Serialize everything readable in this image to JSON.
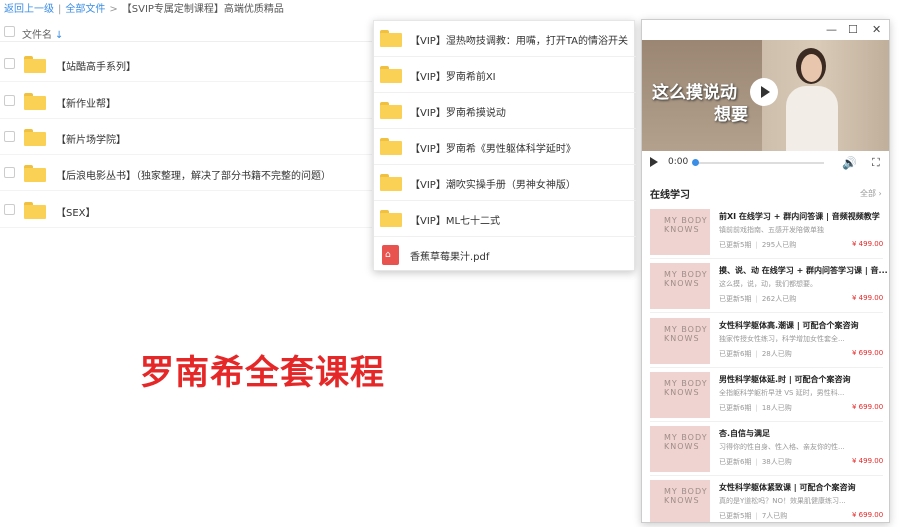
{
  "breadcrumb": {
    "back": "返回上一级",
    "all": "全部文件",
    "sep": ">",
    "current": "【SVIP专属定制课程】高端优质精品"
  },
  "file_list": {
    "header": "文件名",
    "sort_icon": "↓",
    "rows": [
      {
        "name": "【站酷高手系列】"
      },
      {
        "name": "【新作业帮】"
      },
      {
        "name": "【新片场学院】"
      },
      {
        "name": "【后浪电影丛书】（独家整理，解决了部分书籍不完整的问题）"
      },
      {
        "name": "【SEX】"
      }
    ]
  },
  "dropdown": {
    "items": [
      {
        "name": "【VIP】湿热吻技调教：用嘴，打开TA的情浴开关",
        "type": "folder"
      },
      {
        "name": "【VIP】罗南希前XI",
        "type": "folder"
      },
      {
        "name": "【VIP】罗南希摸说动",
        "type": "folder"
      },
      {
        "name": "【VIP】罗南希《男性躯体科学延时》",
        "type": "folder"
      },
      {
        "name": "【VIP】潮吹实操手册（男神女神版）",
        "type": "folder"
      },
      {
        "name": "【VIP】ML七十二式",
        "type": "folder"
      },
      {
        "name": "香蕉草莓果汁.pdf",
        "type": "pdf"
      }
    ]
  },
  "promo_text": "罗南希全套课程",
  "player_window": {
    "controls": {
      "minimize": "—",
      "maximize": "☐",
      "close": "✕"
    },
    "video": {
      "overlay_line1": "这么摸说动",
      "overlay_line2": "想要",
      "time": "0:00"
    },
    "section_title": "在线学习",
    "see_all": "全部 ›",
    "thumb_label": "MY BODY KNOWS",
    "courses": [
      {
        "title": "前XI 在线学习 + 群内问答课 | 音频视频教学",
        "desc": "镇前前戏指南、五感开发陪做单独",
        "updated": "已更新5期",
        "buyers": "295人已购",
        "price": "¥ 499.00"
      },
      {
        "title": "摸、说、动 在线学习 + 群内问答学习课 | 音...",
        "desc": "这么摸，说，动，我们都想要。",
        "updated": "已更新5期",
        "buyers": "262人已购",
        "price": "¥ 499.00"
      },
      {
        "title": "女性科学躯体高.潮课 | 可配合个案咨询",
        "desc": "独家传授女性练习，科学增加女性套全...",
        "updated": "已更新6期",
        "buyers": "28人已购",
        "price": "¥ 699.00"
      },
      {
        "title": "男性科学躯体延.时 | 可配合个案咨询",
        "desc": "全指躯科学躯析早泄 VS 延时，男性科...",
        "updated": "已更新6期",
        "buyers": "18人已购",
        "price": "¥ 699.00"
      },
      {
        "title": "杏.自信与满足",
        "desc": "习得你的性自身、性入格、亲友你的性...",
        "updated": "已更新6期",
        "buyers": "38人已购",
        "price": "¥ 499.00"
      },
      {
        "title": "女性科学躯体紧致课 | 可配合个案咨询",
        "desc": "真的是Y道松吗？NO！效果肌健康练习...",
        "updated": "已更新5期",
        "buyers": "7人已购",
        "price": "¥ 699.00"
      }
    ]
  },
  "colors": {
    "accent": "#3a8ee6",
    "folder": "#fbd155",
    "promo": "#e52727",
    "price": "#e52727"
  }
}
